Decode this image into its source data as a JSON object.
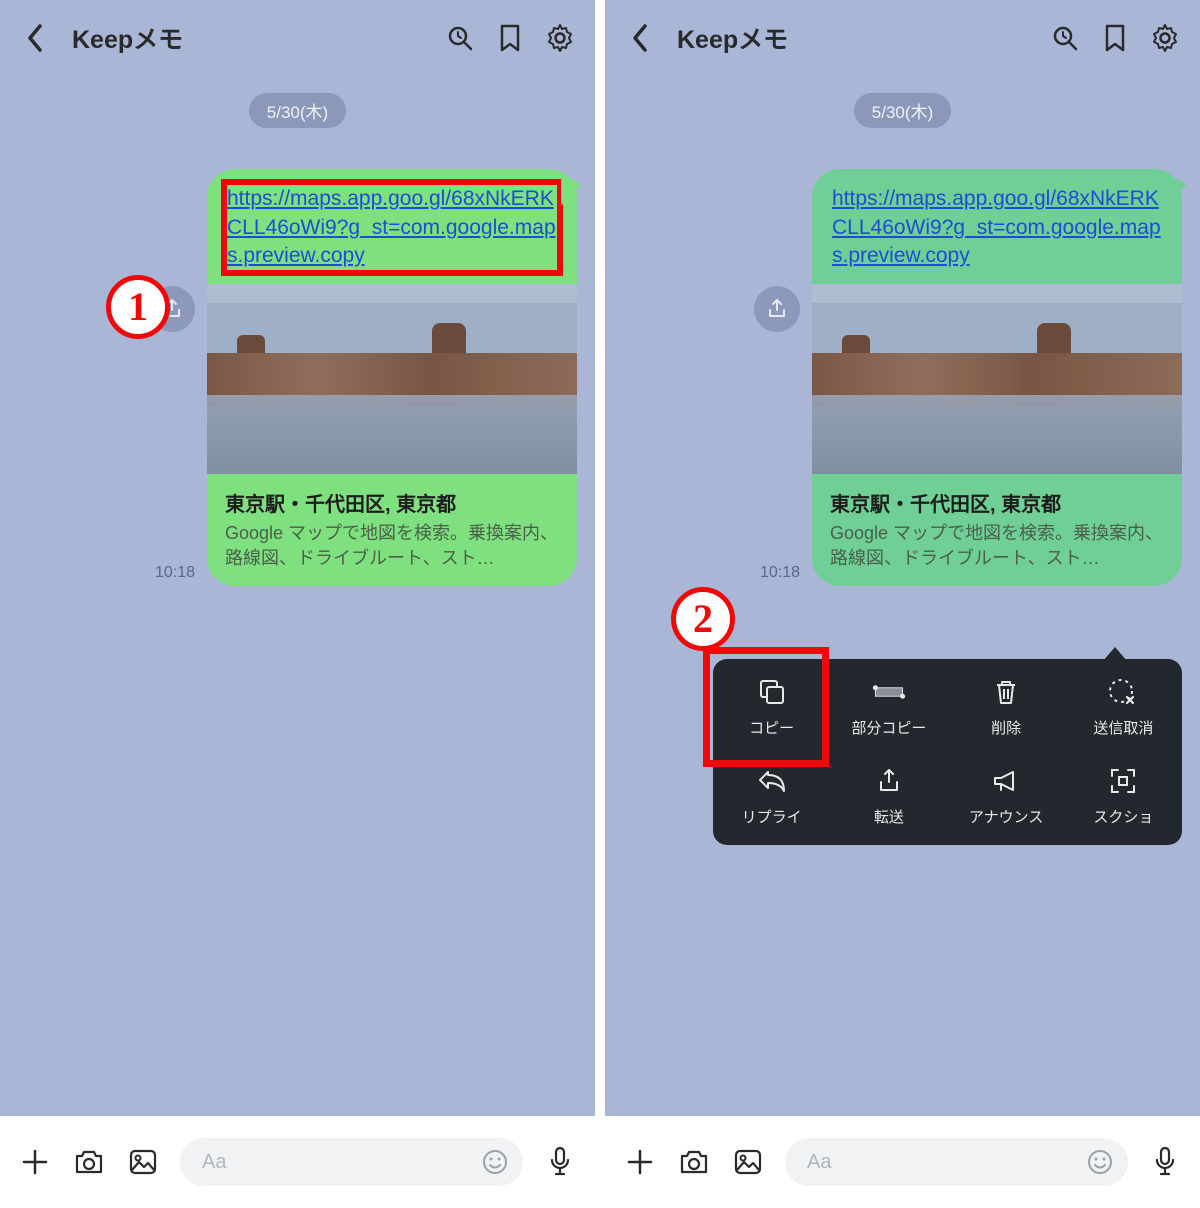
{
  "header": {
    "title": "Keepメモ"
  },
  "chat": {
    "date_label": "5/30(木)",
    "message_url": "https://maps.app.goo.gl/68xNkERKCLL46oWi9?g_st=com.google.maps.preview.copy",
    "preview_title": "東京駅・千代田区, 東京都",
    "preview_desc": "Google マップで地図を検索。乗換案内、路線図、ドライブルート、スト…",
    "timestamp": "10:18"
  },
  "context_menu": {
    "items": [
      {
        "label": "コピー"
      },
      {
        "label": "部分コピー"
      },
      {
        "label": "削除"
      },
      {
        "label": "送信取消"
      },
      {
        "label": "リプライ"
      },
      {
        "label": "転送"
      },
      {
        "label": "アナウンス"
      },
      {
        "label": "スクショ"
      }
    ]
  },
  "input": {
    "placeholder": "Aa"
  },
  "steps": {
    "one": "1",
    "two": "2"
  }
}
